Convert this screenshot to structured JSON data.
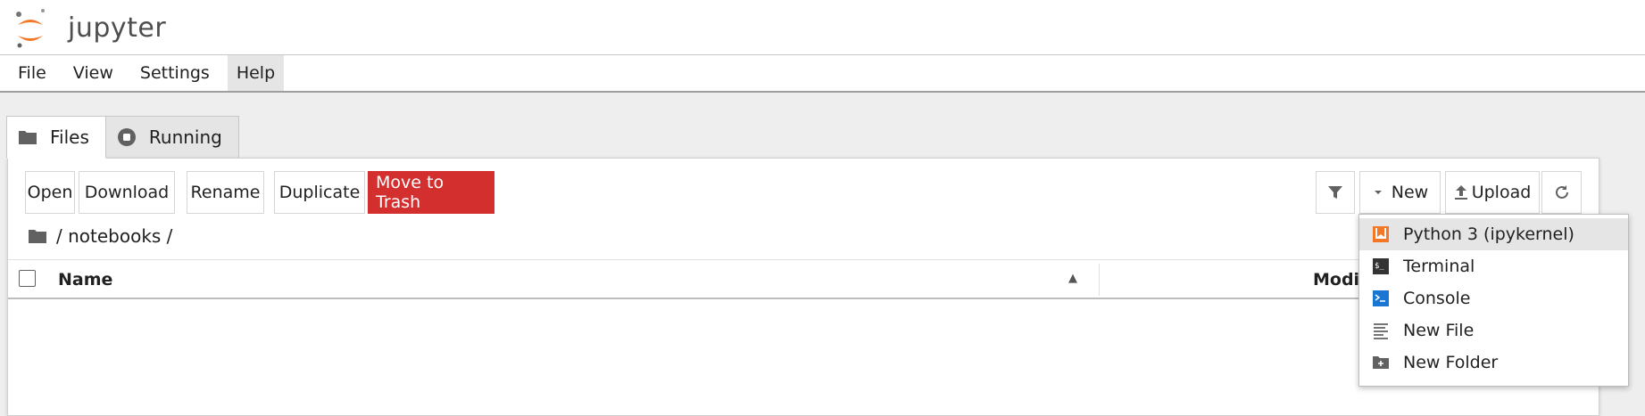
{
  "app": {
    "logo_text": "jupyter"
  },
  "menubar": {
    "items": [
      {
        "label": "File"
      },
      {
        "label": "View"
      },
      {
        "label": "Settings"
      },
      {
        "label": "Help"
      }
    ]
  },
  "tabs": [
    {
      "label": "Files",
      "icon": "folder-icon",
      "active": true
    },
    {
      "label": "Running",
      "icon": "stop-circle-icon",
      "active": false
    }
  ],
  "toolbar": {
    "open": "Open",
    "download": "Download",
    "rename": "Rename",
    "duplicate": "Duplicate",
    "trash": "Move to Trash",
    "new": "New",
    "upload": "Upload"
  },
  "breadcrumb": {
    "path": "/ notebooks /"
  },
  "listing": {
    "columns": {
      "name": "Name",
      "modified": "Modif"
    }
  },
  "new_menu": {
    "items": [
      {
        "label": "Python 3 (ipykernel)",
        "icon": "python-notebook-icon"
      },
      {
        "label": "Terminal",
        "icon": "terminal-icon"
      },
      {
        "label": "Console",
        "icon": "console-icon"
      },
      {
        "label": "New File",
        "icon": "text-file-icon"
      },
      {
        "label": "New Folder",
        "icon": "new-folder-icon"
      }
    ]
  },
  "colors": {
    "accent": "#f37726",
    "danger": "#d32f2f",
    "console_blue": "#1976d2"
  }
}
